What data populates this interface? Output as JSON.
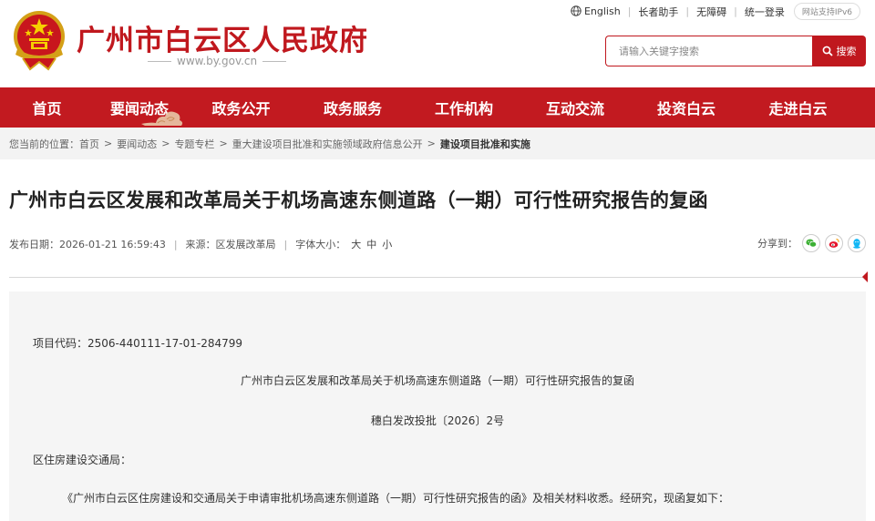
{
  "header": {
    "site_title": "广州市白云区人民政府",
    "site_url": "www.by.gov.cn",
    "top_links": [
      "English",
      "长者助手",
      "无障碍",
      "统一登录"
    ],
    "ipv6_badge": "网站支持IPv6",
    "search": {
      "placeholder": "请输入关键字搜索",
      "button_label": "搜索"
    }
  },
  "nav": {
    "items": [
      {
        "label": "首页"
      },
      {
        "label": "要闻动态"
      },
      {
        "label": "政务公开"
      },
      {
        "label": "政务服务"
      },
      {
        "label": "工作机构"
      },
      {
        "label": "互动交流"
      },
      {
        "label": "投资白云"
      },
      {
        "label": "走进白云"
      }
    ]
  },
  "breadcrumb": {
    "prefix": "您当前的位置：",
    "items": [
      "首页",
      "要闻动态",
      "专题专栏",
      "重大建设项目批准和实施领域政府信息公开",
      "建设项目批准和实施"
    ]
  },
  "article": {
    "title": "广州市白云区发展和改革局关于机场高速东侧道路（一期）可行性研究报告的复函",
    "publish_label": "发布日期：",
    "publish_date": "2026-01-21 16:59:43",
    "source_label": "来源：",
    "source": "区发展改革局",
    "font_size_label": "字体大小：",
    "font_sizes": [
      "大",
      "中",
      "小"
    ],
    "share_label": "分享到：",
    "share_icons": [
      "wechat-icon",
      "weibo-icon",
      "qq-icon"
    ],
    "body": {
      "project_code": "项目代码：2506-440111-17-01-284799",
      "doc_title": "广州市白云区发展和改革局关于机场高速东侧道路（一期）可行性研究报告的复函",
      "doc_number": "穗白发改投批〔2026〕2号",
      "addressee": "区住房建设交通局：",
      "paragraph_1": "《广州市白云区住房建设和交通局关于申请审批机场高速东侧道路（一期）可行性研究报告的函》及相关材料收悉。经研究，现函复如下："
    }
  },
  "colors": {
    "brand_red": "#c21a20",
    "title_red": "#c0181e",
    "breadcrumb_bg": "#f3f3f3",
    "content_bg": "#f5f5f5"
  }
}
